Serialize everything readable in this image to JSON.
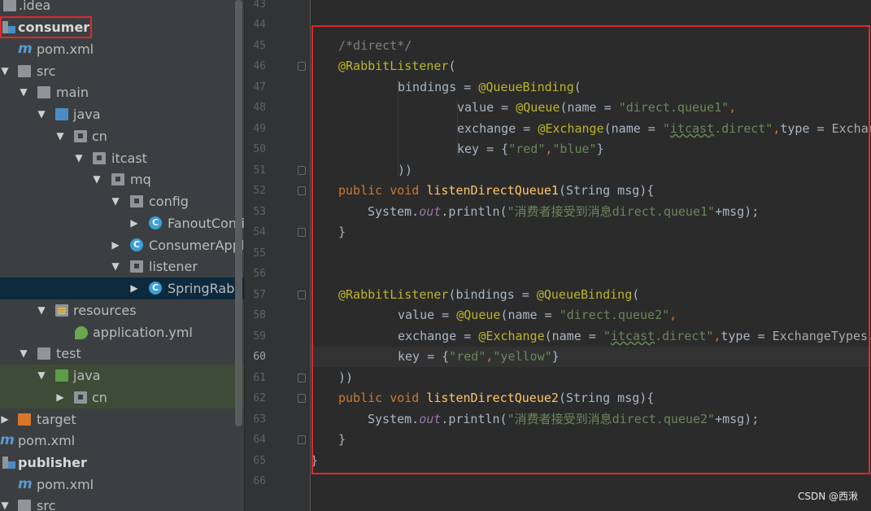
{
  "tree": {
    "items": [
      {
        "label": ".idea"
      },
      {
        "label": "consumer"
      },
      {
        "label": "pom.xml",
        "icon_text": "m"
      },
      {
        "label": "src"
      },
      {
        "label": "main"
      },
      {
        "label": "java"
      },
      {
        "label": "cn"
      },
      {
        "label": "itcast"
      },
      {
        "label": "mq"
      },
      {
        "label": "config"
      },
      {
        "label": "FanoutConfig",
        "icon_text": "C"
      },
      {
        "label": "ConsumerApplication",
        "icon_text": "C"
      },
      {
        "label": "listener"
      },
      {
        "label": "SpringRabbitListener",
        "icon_text": "C"
      },
      {
        "label": "resources"
      },
      {
        "label": "application.yml"
      },
      {
        "label": "test"
      },
      {
        "label": "java"
      },
      {
        "label": "cn"
      },
      {
        "label": "target"
      },
      {
        "label": "pom.xml",
        "icon_text": "m"
      },
      {
        "label": "publisher"
      },
      {
        "label": "pom.xml",
        "icon_text": "m"
      },
      {
        "label": "src"
      }
    ]
  },
  "editor": {
    "line_numbers": [
      "43",
      "44",
      "45",
      "46",
      "47",
      "48",
      "49",
      "50",
      "51",
      "52",
      "53",
      "54",
      "55",
      "56",
      "57",
      "58",
      "59",
      "60",
      "61",
      "62",
      "63",
      "64",
      "65",
      "66"
    ],
    "current_line": "60"
  },
  "code": {
    "l45": "/*direct*/",
    "l46": "@RabbitListener",
    "l47_bindings": "bindings",
    "l47_ann": "@QueueBinding",
    "l48_value": "value",
    "l48_ann": "@Queue",
    "l48_name": "name",
    "l48_str": "\"direct.queue1\"",
    "l49_exchange": "exchange",
    "l49_ann": "@Exchange",
    "l49_name": "name",
    "l49_str_q": "\"",
    "l49_str_u": "itcast",
    "l49_str_r": ".direct\"",
    "l49_type": "type",
    "l49_tail": "ExchangeTypes.DIRECT",
    "l50_key": "key",
    "l50_s1": "\"red\"",
    "l50_s2": "\"blue\"",
    "l51": "))",
    "l52_kw": "public void",
    "l52_fn": "listenDirectQueue1",
    "l52_rest": "(String msg){",
    "l53_sys": "System.",
    "l53_out": "out",
    "l53_print": ".println(",
    "l53_str": "\"消费者接受到消息direct.queue1\"",
    "l53_end": "+msg);",
    "l54": "}",
    "l57_ann": "@RabbitListener",
    "l57_bindings": "bindings",
    "l57_ann2": "@QueueBinding",
    "l58_value": "value",
    "l58_ann": "@Queue",
    "l58_name": "name",
    "l58_str": "\"direct.queue2\"",
    "l59_exchange": "exchange",
    "l59_ann": "@Exchange",
    "l59_name": "name",
    "l59_str_q": "\"",
    "l59_str_u": "itcast",
    "l59_str_r": ".direct\"",
    "l59_type": "type",
    "l59_tail": "ExchangeTypes.DIRECT",
    "l60_key": "key",
    "l60_s1": "\"red\"",
    "l60_s2": "\"yellow\"",
    "l61": "))",
    "l62_kw": "public void",
    "l62_fn": "listenDirectQueue2",
    "l62_rest": "(String msg){",
    "l63_sys": "System.",
    "l63_out": "out",
    "l63_print": ".println(",
    "l63_str": "\"消费者接受到消息direct.queue2\"",
    "l63_end": "+msg);",
    "l64": "}",
    "l65": "}"
  },
  "watermark": "CSDN @西湫",
  "colors": {
    "highlight_box": "#e0272e",
    "selected_row": "#0d293e"
  }
}
